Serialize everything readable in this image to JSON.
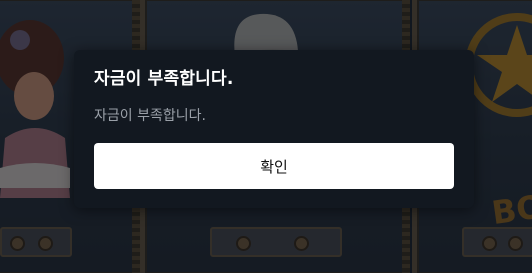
{
  "dialog": {
    "title": "자금이 부족합니다.",
    "message": "자금이 부족합니다.",
    "confirm_label": "확인"
  },
  "background": {
    "reel_symbols": [
      "saloon-lady-icon",
      "cowboy-hat-icon",
      "sheriff-star-icon"
    ],
    "partial_logo_text": "BO"
  },
  "colors": {
    "dialog_bg": "#121820",
    "button_bg": "#ffffff",
    "title_text": "#ffffff",
    "message_text": "#9aa0a8"
  }
}
